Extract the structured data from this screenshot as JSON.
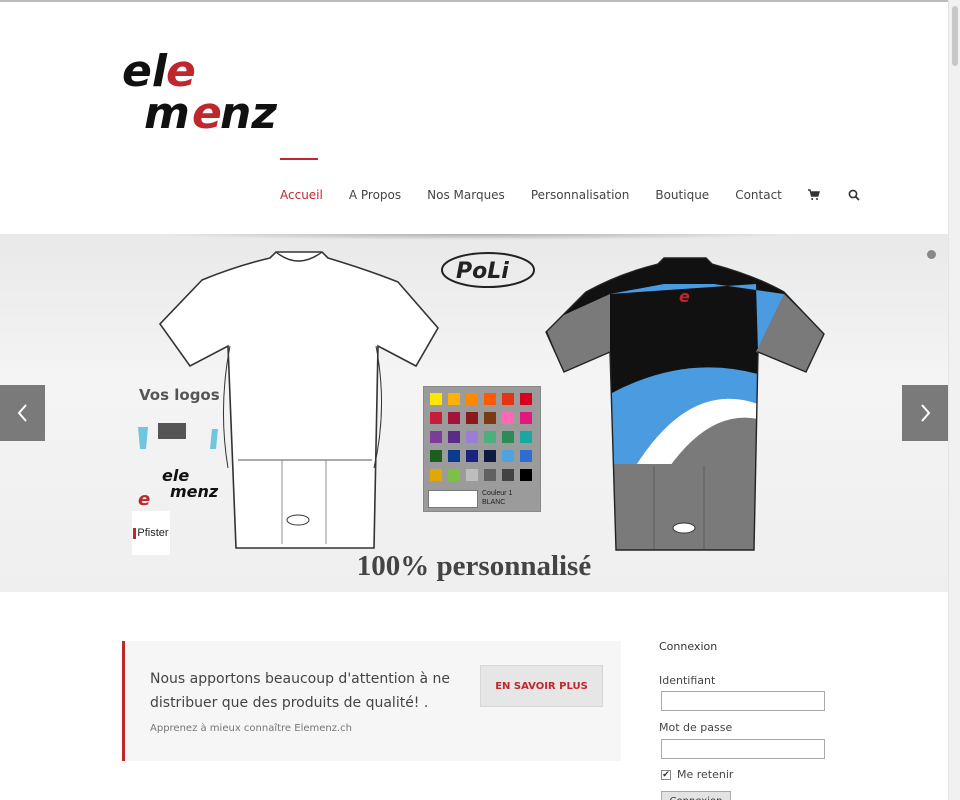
{
  "brand": {
    "logo_line1": "ele",
    "logo_line2": "menz",
    "accent": "#c0272d"
  },
  "nav": {
    "items": [
      {
        "label": "Accueil",
        "active": true
      },
      {
        "label": "A Propos",
        "active": false
      },
      {
        "label": "Nos Marques",
        "active": false
      },
      {
        "label": "Personnalisation",
        "active": false
      },
      {
        "label": "Boutique",
        "active": false
      },
      {
        "label": "Contact",
        "active": false
      }
    ],
    "icons": [
      "cart-icon",
      "search-icon"
    ]
  },
  "slider": {
    "poli_label": "PoLi",
    "vos_logos": "Vos logos",
    "pfister": "Pfister",
    "palette_label_line1": "Couleur 1",
    "palette_label_line2": "BLANC",
    "caption": "100% personnalisé",
    "palette_colors": [
      "#ffe600",
      "#ffb000",
      "#ff8a00",
      "#ff5a00",
      "#e63312",
      "#d7001e",
      "#c41e3a",
      "#a5123a",
      "#8b1a1a",
      "#7a3b12",
      "#ff69b4",
      "#e0197d",
      "#7d3c98",
      "#5b2c83",
      "#9b7fd6",
      "#4caf7d",
      "#2e8b57",
      "#1aa7a0",
      "#1b5e20",
      "#0b3c8c",
      "#1a237e",
      "#0d1b3e",
      "#4fa3e0",
      "#2d6fd1",
      "#e0a800",
      "#7cc142",
      "#bdbdbd",
      "#616161",
      "#424242",
      "#000000"
    ]
  },
  "tagline": {
    "message": "Nous apportons beaucoup d'attention à ne distribuer que des produits de qualité! .",
    "sub": "Apprenez à mieux connaître Elemenz.ch",
    "button": "EN SAVOIR PLUS"
  },
  "login": {
    "title": "Connexion",
    "username_label": "Identifiant",
    "password_label": "Mot de passe",
    "remember_label": "Me retenir",
    "remember_checked": true,
    "submit": "Connexion"
  }
}
